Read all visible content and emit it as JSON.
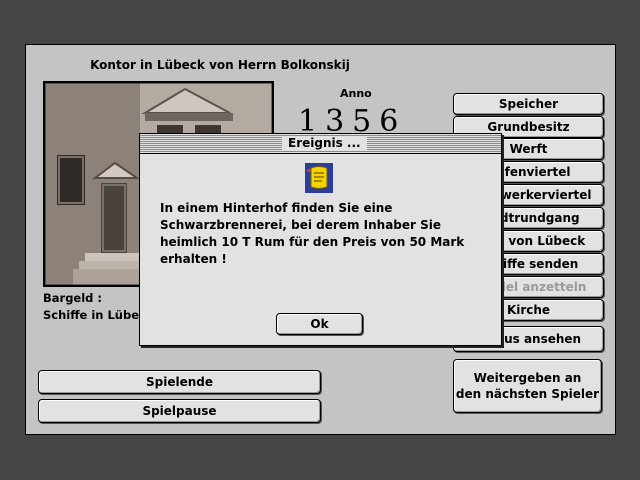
{
  "kontor": {
    "title": "Kontor in Lübeck von Herrn Bolkonskij",
    "anno_label": "Anno",
    "year": "1356",
    "bargeld_label": "Bargeld :",
    "schiffe_label": "Schiffe in Lübeck"
  },
  "side_buttons": [
    {
      "label": "Speicher",
      "enabled": true
    },
    {
      "label": "Grundbesitz",
      "enabled": true
    },
    {
      "label": "Werft",
      "enabled": true
    },
    {
      "label": "Hafenviertel",
      "enabled": true
    },
    {
      "label": "Handwerkerviertel",
      "enabled": true
    },
    {
      "label": "Stadtrundgang",
      "enabled": true
    },
    {
      "label": "Blick von Lübeck",
      "enabled": true
    },
    {
      "label": "Schiffe senden",
      "enabled": true
    },
    {
      "label": "Handel anzetteln",
      "enabled": false
    },
    {
      "label": "Kirche",
      "enabled": true
    },
    {
      "label": "Status ansehen",
      "enabled": true
    }
  ],
  "weitergeben": {
    "line1": "Weitergeben an",
    "line2": "den nächsten Spieler"
  },
  "bottom_buttons": {
    "spielende": "Spielende",
    "spielpause": "Spielpause"
  },
  "dialog": {
    "title": "Ereignis ...",
    "icon": "scroll-message-icon",
    "message_lines": [
      "In einem Hinterhof finden Sie eine",
      "Schwarzbrennerei, bei derem Inhaber Sie",
      "heimlich 10 T Rum für den Preis von 50 Mark",
      "erhalten !"
    ],
    "ok_label": "Ok"
  },
  "colors": {
    "background": "#454545",
    "panel": "#c4c4c4",
    "button": "#e2e2e2",
    "icon_blue": "#2b3f9a",
    "icon_yellow": "#f2d400"
  }
}
